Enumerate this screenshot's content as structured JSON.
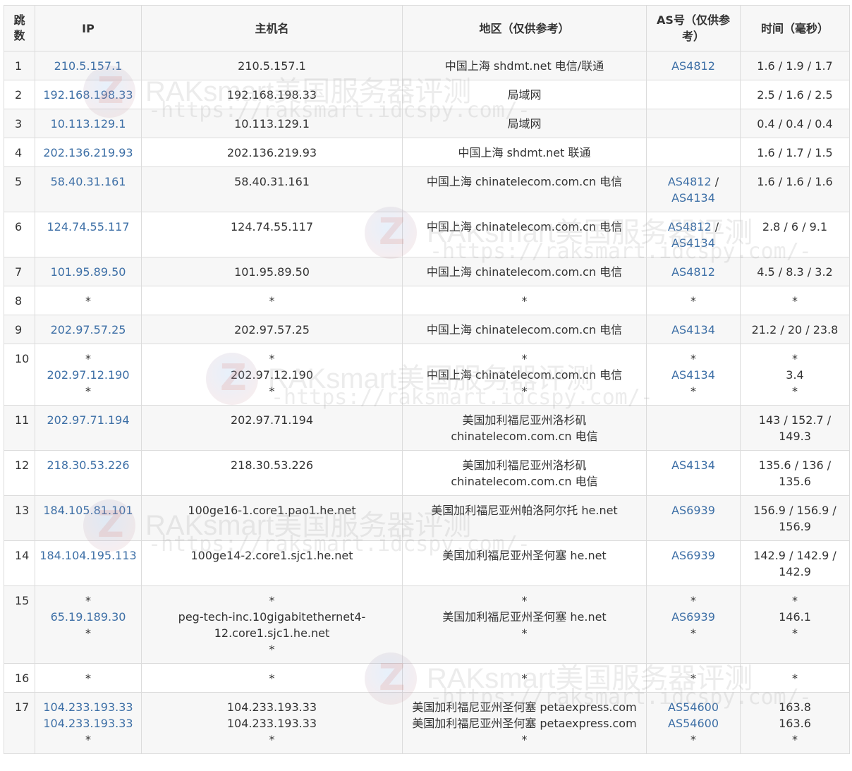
{
  "headers": {
    "hop": "跳数",
    "ip": "IP",
    "host": "主机名",
    "region": "地区（仅供参考）",
    "as": "AS号（仅供参考）",
    "time": "时间（毫秒）"
  },
  "rows": [
    {
      "hop": "1",
      "ip": [
        "210.5.157.1"
      ],
      "host": [
        "210.5.157.1"
      ],
      "region": [
        "中国上海 shdmt.net 电信/联通"
      ],
      "as": [
        [
          "AS4812"
        ]
      ],
      "time": [
        "1.6 / 1.9 / 1.7"
      ]
    },
    {
      "hop": "2",
      "ip": [
        "192.168.198.33"
      ],
      "host": [
        "192.168.198.33"
      ],
      "region": [
        "局域网"
      ],
      "as": [
        []
      ],
      "time": [
        "2.5 / 1.6 / 2.5"
      ]
    },
    {
      "hop": "3",
      "ip": [
        "10.113.129.1"
      ],
      "host": [
        "10.113.129.1"
      ],
      "region": [
        "局域网"
      ],
      "as": [
        []
      ],
      "time": [
        "0.4 / 0.4 / 0.4"
      ]
    },
    {
      "hop": "4",
      "ip": [
        "202.136.219.93"
      ],
      "host": [
        "202.136.219.93"
      ],
      "region": [
        "中国上海 shdmt.net 联通"
      ],
      "as": [
        []
      ],
      "time": [
        "1.6 / 1.7 / 1.5"
      ]
    },
    {
      "hop": "5",
      "ip": [
        "58.40.31.161"
      ],
      "host": [
        "58.40.31.161"
      ],
      "region": [
        "中国上海 chinatelecom.com.cn 电信"
      ],
      "as": [
        [
          "AS4812",
          "AS4134"
        ]
      ],
      "time": [
        "1.6 / 1.6 / 1.6"
      ]
    },
    {
      "hop": "6",
      "ip": [
        "124.74.55.117"
      ],
      "host": [
        "124.74.55.117"
      ],
      "region": [
        "中国上海 chinatelecom.com.cn 电信"
      ],
      "as": [
        [
          "AS4812",
          "AS4134"
        ]
      ],
      "time": [
        "2.8 / 6 / 9.1"
      ]
    },
    {
      "hop": "7",
      "ip": [
        "101.95.89.50"
      ],
      "host": [
        "101.95.89.50"
      ],
      "region": [
        "中国上海 chinatelecom.com.cn 电信"
      ],
      "as": [
        [
          "AS4812"
        ]
      ],
      "time": [
        "4.5 / 8.3 / 3.2"
      ]
    },
    {
      "hop": "8",
      "ip": [
        "*"
      ],
      "host": [
        "*"
      ],
      "region": [
        "*"
      ],
      "as": [
        [
          "*"
        ]
      ],
      "time": [
        "*"
      ]
    },
    {
      "hop": "9",
      "ip": [
        "202.97.57.25"
      ],
      "host": [
        "202.97.57.25"
      ],
      "region": [
        "中国上海 chinatelecom.com.cn 电信"
      ],
      "as": [
        [
          "AS4134"
        ]
      ],
      "time": [
        "21.2 / 20 / 23.8"
      ]
    },
    {
      "hop": "10",
      "ip": [
        "*",
        "202.97.12.190",
        "*"
      ],
      "host": [
        "*",
        "202.97.12.190",
        "*"
      ],
      "region": [
        "*",
        "中国上海 chinatelecom.com.cn 电信",
        "*"
      ],
      "as": [
        [
          "*"
        ],
        [
          "AS4134"
        ],
        [
          "*"
        ]
      ],
      "time": [
        "*",
        "3.4",
        "*"
      ]
    },
    {
      "hop": "11",
      "ip": [
        "202.97.71.194"
      ],
      "host": [
        "202.97.71.194"
      ],
      "region": [
        "美国加利福尼亚州洛杉矶",
        "chinatelecom.com.cn 电信"
      ],
      "as": [
        []
      ],
      "time": [
        "143 / 152.7 /",
        "149.3"
      ]
    },
    {
      "hop": "12",
      "ip": [
        "218.30.53.226"
      ],
      "host": [
        "218.30.53.226"
      ],
      "region": [
        "美国加利福尼亚州洛杉矶",
        "chinatelecom.com.cn 电信"
      ],
      "as": [
        [
          "AS4134"
        ]
      ],
      "time": [
        "135.6 / 136 /",
        "135.6"
      ]
    },
    {
      "hop": "13",
      "ip": [
        "184.105.81.101"
      ],
      "host": [
        "100ge16-1.core1.pao1.he.net"
      ],
      "region": [
        "美国加利福尼亚州帕洛阿尔托 he.net"
      ],
      "as": [
        [
          "AS6939"
        ]
      ],
      "time": [
        "156.9 / 156.9 /",
        "156.9"
      ]
    },
    {
      "hop": "14",
      "ip": [
        "184.104.195.113"
      ],
      "host": [
        "100ge14-2.core1.sjc1.he.net"
      ],
      "region": [
        "美国加利福尼亚州圣何塞 he.net"
      ],
      "as": [
        [
          "AS6939"
        ]
      ],
      "time": [
        "142.9 / 142.9 /",
        "142.9"
      ]
    },
    {
      "hop": "15",
      "ip": [
        "*",
        "65.19.189.30",
        "*"
      ],
      "host": [
        "*",
        "peg-tech-inc.10gigabitethernet4-",
        "12.core1.sjc1.he.net",
        "*"
      ],
      "region": [
        "*",
        "美国加利福尼亚州圣何塞 he.net",
        "*"
      ],
      "as": [
        [
          "*"
        ],
        [
          "AS6939"
        ],
        [
          "*"
        ]
      ],
      "time": [
        "*",
        "146.1",
        "*"
      ]
    },
    {
      "hop": "16",
      "ip": [
        "*"
      ],
      "host": [
        "*"
      ],
      "region": [
        "*"
      ],
      "as": [
        [
          "*"
        ]
      ],
      "time": [
        "*"
      ]
    },
    {
      "hop": "17",
      "ip": [
        "104.233.193.33",
        "104.233.193.33",
        "*"
      ],
      "host": [
        "104.233.193.33",
        "104.233.193.33",
        "*"
      ],
      "region": [
        "美国加利福尼亚州圣何塞 petaexpress.com",
        "美国加利福尼亚州圣何塞 petaexpress.com",
        "*"
      ],
      "as": [
        [
          "AS54600"
        ],
        [
          "AS54600"
        ],
        [
          "*"
        ]
      ],
      "time": [
        "163.8",
        "163.6",
        "*"
      ]
    }
  ],
  "watermark": {
    "title": "RAKsmart美国服务器评测",
    "url": "-https://raksmart.idcspy.com/-"
  }
}
